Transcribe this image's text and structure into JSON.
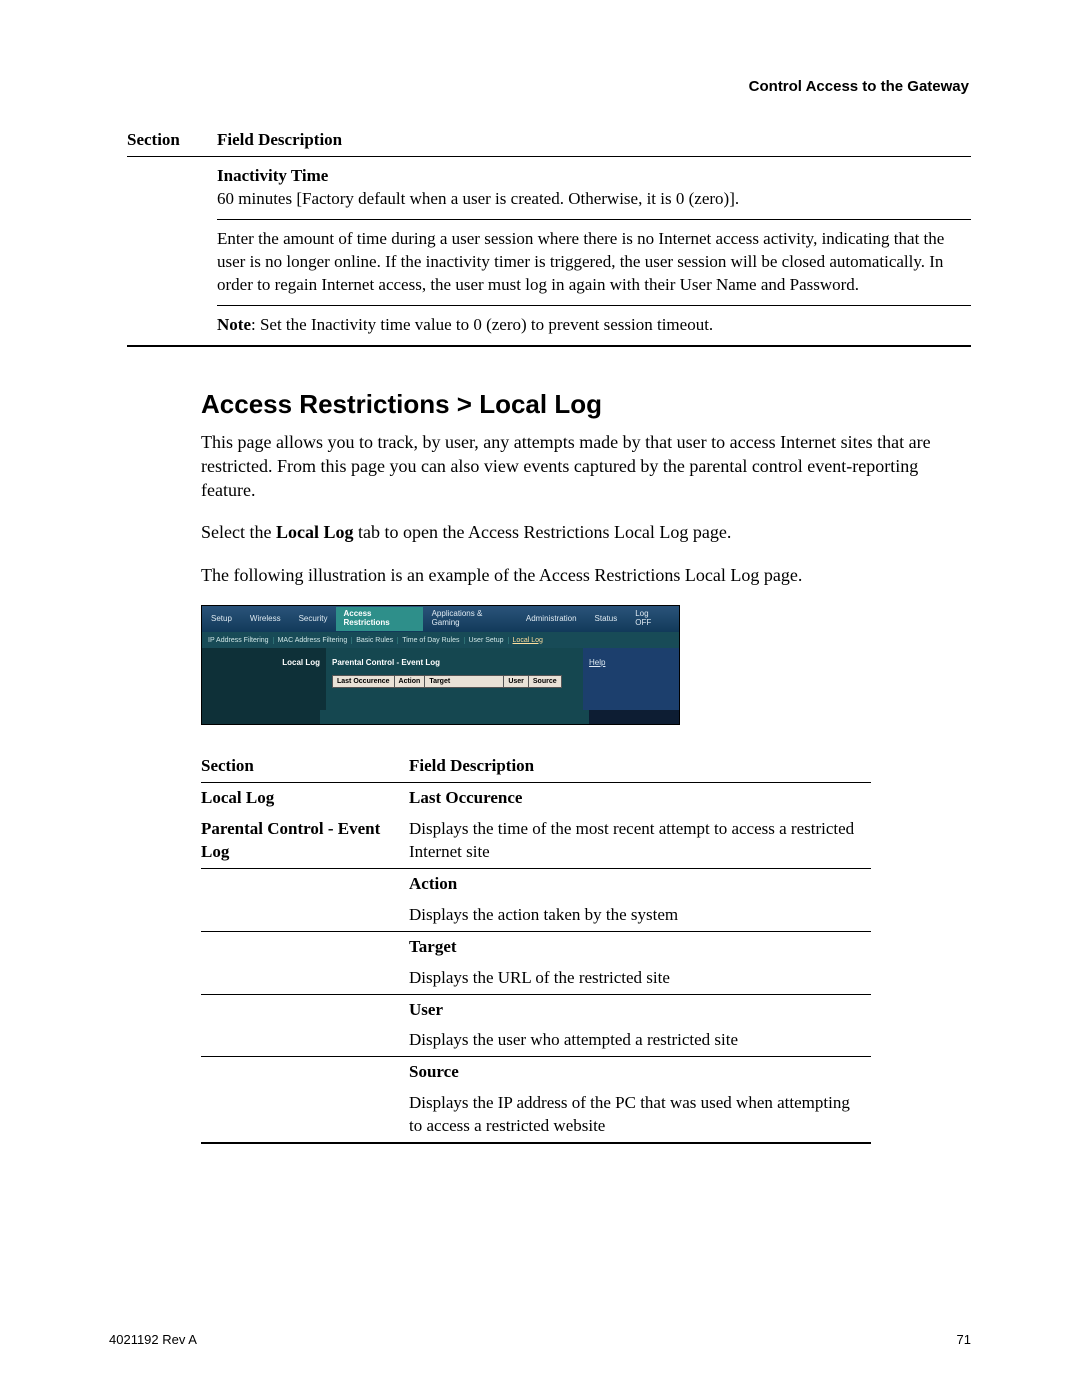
{
  "gateway_title": "Control Access to the Gateway",
  "table1": {
    "headers": [
      "Section",
      "Field Description"
    ],
    "row1_title": "Inactivity Time",
    "row1_text": "60 minutes [Factory default when a user is created. Otherwise, it is 0 (zero)].",
    "row2": "Enter the amount of time during a user session where there is no Internet access activity, indicating that the user is no longer online. If the inactivity timer is triggered, the user session will be closed automatically. In order to regain Internet access, the user must log in again with their User Name and Password.",
    "row3_label": "Note",
    "row3_text": ": Set the Inactivity time value to 0 (zero) to prevent session timeout."
  },
  "heading": "Access Restrictions > Local Log",
  "para1": "This page allows you to track, by user, any attempts made by that user to access Internet sites that are restricted. From this page you can also view events captured by the parental control event-reporting feature.",
  "para2_pre": "Select the ",
  "para2_bold": "Local Log",
  "para2_post": " tab to open the Access Restrictions Local Log page.",
  "para3": "The following illustration is an example of the Access Restrictions Local Log page.",
  "router": {
    "tabs": [
      "Setup",
      "Wireless",
      "Security",
      "Access Restrictions",
      "Applications & Gaming",
      "Administration",
      "Status",
      "Log OFF"
    ],
    "subtabs": [
      "IP Address Filtering",
      "MAC Address Filtering",
      "Basic Rules",
      "Time of Day Rules",
      "User Setup",
      "Local Log"
    ],
    "left_label": "Local Log",
    "mid_title": "Parental Control - Event Log",
    "cols": [
      "Last Occurence",
      "Action",
      "Target",
      "User",
      "Source"
    ],
    "help": "Help"
  },
  "table2": {
    "headers": [
      "Section",
      "Field Description"
    ],
    "section_line1": "Local Log",
    "section_line2": "Parental Control - Event Log",
    "rows": [
      {
        "h": "Last Occurence",
        "t": "Displays the time of the most recent attempt to access a restricted Internet site"
      },
      {
        "h": "Action",
        "t": "Displays the action taken by the system"
      },
      {
        "h": "Target",
        "t": "Displays the URL of the restricted site"
      },
      {
        "h": "User",
        "t": "Displays the user who attempted a restricted site"
      },
      {
        "h": "Source",
        "t": "Displays the IP address of the PC that was used when attempting to access a restricted website"
      }
    ]
  },
  "footer_left": "4021192 Rev A",
  "footer_right": "71"
}
